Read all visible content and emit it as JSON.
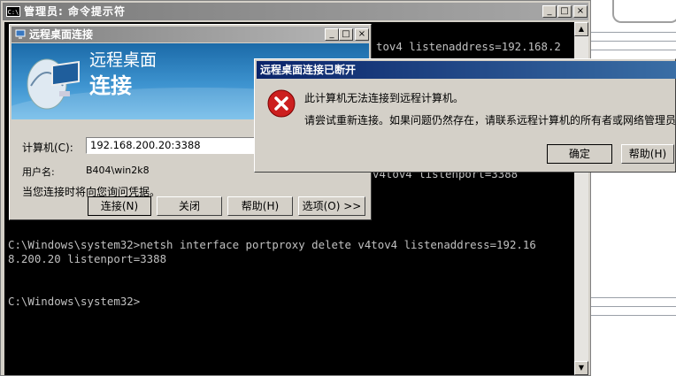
{
  "console": {
    "title": "管理员: 命令提示符",
    "icon_text": "C:\\",
    "lines_top_right": [
      "tov4 listenaddress=192.168.2",
      "",
      "",
      "",
      "",
      "",
      "",
      "",
      "v4tov4 listenport=3388"
    ],
    "lines": [
      "C:\\Windows\\system32>netsh interface portproxy delete v4tov4 listenaddress=192.16",
      "8.200.20 listenport=3388",
      "",
      "C:\\Windows\\system32>"
    ],
    "buttons": {
      "minimize": "_",
      "maximize": "□",
      "close": "×"
    }
  },
  "rdp": {
    "title": "远程桌面连接",
    "banner_line1": "远程桌面",
    "banner_line2": "连接",
    "computer_label": "计算机(C):",
    "computer_value": "192.168.200.20:3388",
    "user_label": "用户名:",
    "user_value": "B404\\win2k8",
    "hint": "当您连接时将向您询问凭据。",
    "buttons": {
      "connect": "连接(N)",
      "close": "关闭",
      "help": "帮助(H)",
      "options": "选项(O) >>"
    }
  },
  "error_dialog": {
    "title": "远程桌面连接已断开",
    "line1": "此计算机无法连接到远程计算机。",
    "line2": "请尝试重新连接。如果问题仍然存在，请联系远程计算机的所有者或网络管理员",
    "ok_label": "确定",
    "help_label": "帮助(H)"
  },
  "colors": {
    "console_bg": "#000000",
    "console_text": "#c0c0c0",
    "dialog_title": "#0a246a",
    "error_red": "#cc1f1f"
  }
}
